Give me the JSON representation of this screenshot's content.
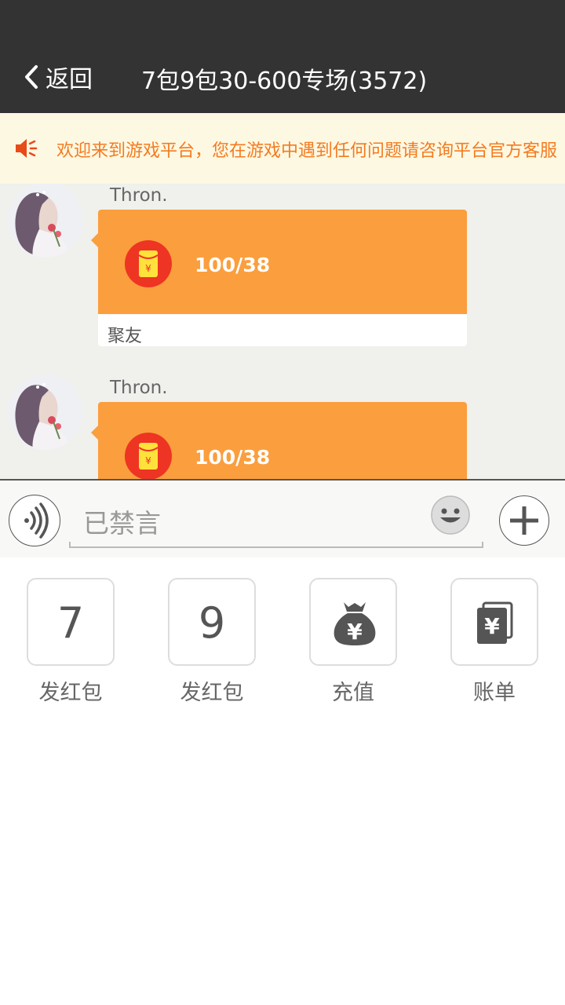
{
  "header": {
    "back_label": "返回",
    "title": "7包9包30-600专场(3572)"
  },
  "notice": {
    "text": "欢迎来到游戏平台，您在游戏中遇到任何问题请咨询平台官方客服"
  },
  "messages": [
    {
      "sender": "Thron.",
      "amount": "100/38",
      "footer": "聚友"
    },
    {
      "sender": "Thron.",
      "amount": "100/38",
      "footer": ""
    }
  ],
  "input": {
    "placeholder": "已禁言"
  },
  "actions": [
    {
      "glyph": "7",
      "label": "发红包"
    },
    {
      "glyph": "9",
      "label": "发红包"
    },
    {
      "glyph": "",
      "label": "充值",
      "icon": "money-bag-icon"
    },
    {
      "glyph": "",
      "label": "账单",
      "icon": "bill-icon"
    }
  ],
  "colors": {
    "header_bg": "#333333",
    "notice_bg": "#fdf8e2",
    "notice_text": "#f47b20",
    "card_orange": "#fb9e3d",
    "redpack_red": "#ee3423",
    "chat_bg": "#f0f0ed"
  }
}
